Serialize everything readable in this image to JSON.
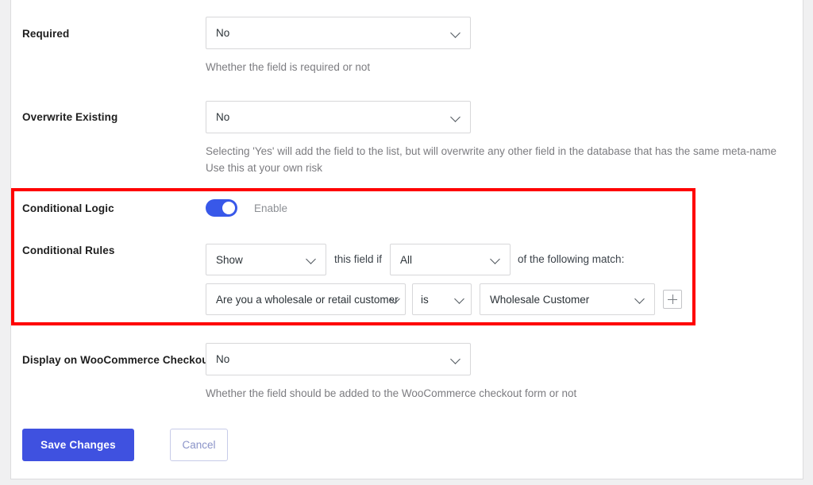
{
  "fields": {
    "required": {
      "label": "Required",
      "value": "No",
      "description": "Whether the field is required or not"
    },
    "overwrite_existing": {
      "label": "Overwrite Existing",
      "value": "No",
      "description": "Selecting 'Yes' will add the field to the list, but will overwrite any other field in the database that has the same meta-name\nUse this at your own risk"
    },
    "conditional_logic": {
      "label": "Conditional Logic",
      "toggle_label": "Enable",
      "enabled": true
    },
    "conditional_rules": {
      "label": "Conditional Rules",
      "action": "Show",
      "text_after_action": "this field if",
      "match_type": "All",
      "text_after_match": "of the following match:",
      "rule": {
        "field": "Are you a wholesale or retail customer",
        "operator": "is",
        "value": "Wholesale Customer"
      },
      "add_rule_icon": "plus-icon"
    },
    "display_on_checkout": {
      "label": "Display on WooCommerce Checkout",
      "value": "No",
      "description": "Whether the field should be added to the WooCommerce checkout form or not"
    }
  },
  "actions": {
    "save_label": "Save Changes",
    "cancel_label": "Cancel"
  },
  "colors": {
    "primary_button": "#3f51e0",
    "toggle_on": "#3858e9",
    "highlight_border": "#ff0000"
  }
}
